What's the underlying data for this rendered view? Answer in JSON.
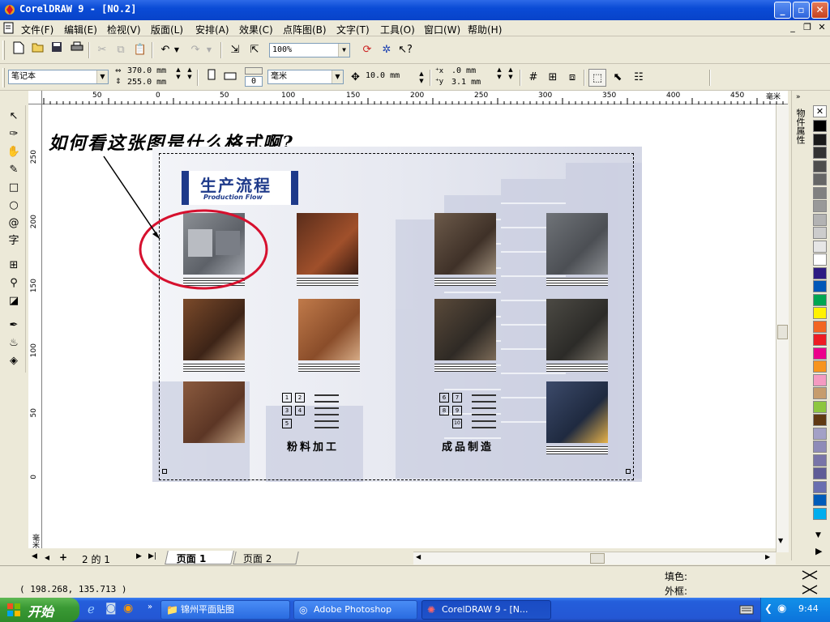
{
  "titlebar": {
    "title": "CorelDRAW 9 - [NO.2]"
  },
  "menu": [
    "文件(F)",
    "编辑(E)",
    "检视(V)",
    "版面(L)",
    "安排(A)",
    "效果(C)",
    "点阵图(B)",
    "文字(T)",
    "工具(O)",
    "窗口(W)",
    "帮助(H)"
  ],
  "standard_toolbar": {
    "zoom": "100%"
  },
  "property_bar": {
    "paper_preset": "笔记本",
    "width": "370.0 mm",
    "height": "255.0 mm",
    "units": "毫米",
    "nudge": "10.0 mm",
    "dup_x": ".0 mm",
    "dup_y": "3.1 mm",
    "page_count_field": "0"
  },
  "ruler": {
    "h_labels": [
      "50",
      "0",
      "50",
      "100",
      "150",
      "200",
      "250",
      "300",
      "350",
      "400",
      "450"
    ],
    "h_unit": "毫米",
    "v_labels": [
      "250",
      "200",
      "150",
      "100",
      "50",
      "0"
    ],
    "v_unit": "毫米"
  },
  "document": {
    "annotation": "如何看这张图是什么格式啊?",
    "heading_cn": "生产流程",
    "heading_en": "Production Flow",
    "section_left": "粉料加工",
    "section_right": "成品制造",
    "steps_left": [
      "1",
      "2",
      "3",
      "4",
      "5"
    ],
    "steps_right": [
      "6",
      "7",
      "8",
      "9",
      "10"
    ]
  },
  "docker": {
    "label": "物件属性"
  },
  "page_tabs": {
    "counter": "2 的 1",
    "page1": "页面 1",
    "page2": "页面 2"
  },
  "status": {
    "coords": "( 198.268, 135.713 )",
    "fill_label": "填色:",
    "outline_label": "外框:"
  },
  "taskbar": {
    "start": "开始",
    "tasks": [
      "锦州平面贴图",
      "Adobe Photoshop",
      "CorelDRAW 9 - [N..."
    ],
    "clock": "9:44"
  },
  "colors": {
    "palette": [
      "#000000",
      "#1a1a1a",
      "#333333",
      "#4d4d4d",
      "#666666",
      "#808080",
      "#999999",
      "#b3b3b3",
      "#cccccc",
      "#e6e6e6",
      "#ffffff",
      "#2d1b82",
      "#0057b8",
      "#00a651",
      "#fff200",
      "#f26522",
      "#ed1c24",
      "#ec008c",
      "#f7941d",
      "#f49ac1",
      "#c69c6d",
      "#8dc63f",
      "#603913",
      "#a3a0c6",
      "#8e8bb8",
      "#7874a8",
      "#5f5c97",
      "#6a6fb0",
      "#005cb9",
      "#00adee"
    ],
    "title_blue": "#0a4bd6",
    "heading_blue": "#1e3a8a",
    "annotation_red": "#d6102e"
  }
}
